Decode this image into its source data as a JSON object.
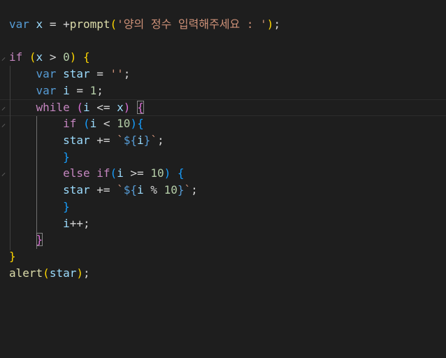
{
  "editor": {
    "language": "javascript",
    "theme_background": "#1e1e1e",
    "lines": [
      {
        "tokens": [
          [
            "kw",
            "var"
          ],
          [
            "op",
            " "
          ],
          [
            "var",
            "x"
          ],
          [
            "op",
            " = +"
          ],
          [
            "fn",
            "prompt"
          ],
          [
            "b1",
            "("
          ],
          [
            "str",
            "'양의 정수 입력해주세요 : '"
          ],
          [
            "b1",
            ")"
          ],
          [
            "op",
            ";"
          ]
        ]
      },
      {
        "tokens": []
      },
      {
        "tokens": [
          [
            "ctrl",
            "if"
          ],
          [
            "op",
            " "
          ],
          [
            "b1",
            "("
          ],
          [
            "var",
            "x"
          ],
          [
            "op",
            " > "
          ],
          [
            "num",
            "0"
          ],
          [
            "b1",
            ")"
          ],
          [
            "op",
            " "
          ],
          [
            "b1",
            "{"
          ]
        ]
      },
      {
        "tokens": [
          [
            "op",
            "    "
          ],
          [
            "kw",
            "var"
          ],
          [
            "op",
            " "
          ],
          [
            "var",
            "star"
          ],
          [
            "op",
            " = "
          ],
          [
            "str",
            "''"
          ],
          [
            "op",
            ";"
          ]
        ]
      },
      {
        "tokens": [
          [
            "op",
            "    "
          ],
          [
            "kw",
            "var"
          ],
          [
            "op",
            " "
          ],
          [
            "var",
            "i"
          ],
          [
            "op",
            " = "
          ],
          [
            "num",
            "1"
          ],
          [
            "op",
            ";"
          ]
        ]
      },
      {
        "tokens": [
          [
            "op",
            "    "
          ],
          [
            "ctrl",
            "while"
          ],
          [
            "op",
            " "
          ],
          [
            "b2",
            "("
          ],
          [
            "var",
            "i"
          ],
          [
            "op",
            " <= "
          ],
          [
            "var",
            "x"
          ],
          [
            "b2",
            ")"
          ],
          [
            "op",
            " "
          ],
          [
            "b2box",
            "{"
          ]
        ]
      },
      {
        "tokens": [
          [
            "op",
            "        "
          ],
          [
            "ctrl",
            "if"
          ],
          [
            "op",
            " "
          ],
          [
            "b3",
            "("
          ],
          [
            "var",
            "i"
          ],
          [
            "op",
            " < "
          ],
          [
            "num",
            "10"
          ],
          [
            "b3",
            ")"
          ],
          [
            "b3",
            "{"
          ]
        ]
      },
      {
        "tokens": [
          [
            "op",
            "        "
          ],
          [
            "var",
            "star"
          ],
          [
            "op",
            " += "
          ],
          [
            "str",
            "`"
          ],
          [
            "kw",
            "${"
          ],
          [
            "var",
            "i"
          ],
          [
            "kw",
            "}"
          ],
          [
            "str",
            "`"
          ],
          [
            "op",
            ";"
          ]
        ]
      },
      {
        "tokens": [
          [
            "op",
            "        "
          ],
          [
            "b3",
            "}"
          ]
        ]
      },
      {
        "tokens": [
          [
            "op",
            "        "
          ],
          [
            "ctrl",
            "else"
          ],
          [
            "op",
            " "
          ],
          [
            "ctrl",
            "if"
          ],
          [
            "b3",
            "("
          ],
          [
            "var",
            "i"
          ],
          [
            "op",
            " >= "
          ],
          [
            "num",
            "10"
          ],
          [
            "b3",
            ")"
          ],
          [
            "op",
            " "
          ],
          [
            "b3",
            "{"
          ]
        ]
      },
      {
        "tokens": [
          [
            "op",
            "        "
          ],
          [
            "var",
            "star"
          ],
          [
            "op",
            " += "
          ],
          [
            "str",
            "`"
          ],
          [
            "kw",
            "${"
          ],
          [
            "var",
            "i"
          ],
          [
            "op",
            " % "
          ],
          [
            "num",
            "10"
          ],
          [
            "kw",
            "}"
          ],
          [
            "str",
            "`"
          ],
          [
            "op",
            ";"
          ]
        ]
      },
      {
        "tokens": [
          [
            "op",
            "        "
          ],
          [
            "b3",
            "}"
          ]
        ]
      },
      {
        "tokens": [
          [
            "op",
            "        "
          ],
          [
            "var",
            "i"
          ],
          [
            "op",
            "++;"
          ]
        ]
      },
      {
        "tokens": [
          [
            "op",
            "    "
          ],
          [
            "b2box",
            "}"
          ]
        ]
      },
      {
        "tokens": [
          [
            "b1",
            "}"
          ]
        ]
      },
      {
        "tokens": [
          [
            "fn",
            "alert"
          ],
          [
            "b1",
            "("
          ],
          [
            "var",
            "star"
          ],
          [
            "b1",
            ")"
          ],
          [
            "op",
            ";"
          ]
        ]
      }
    ]
  }
}
